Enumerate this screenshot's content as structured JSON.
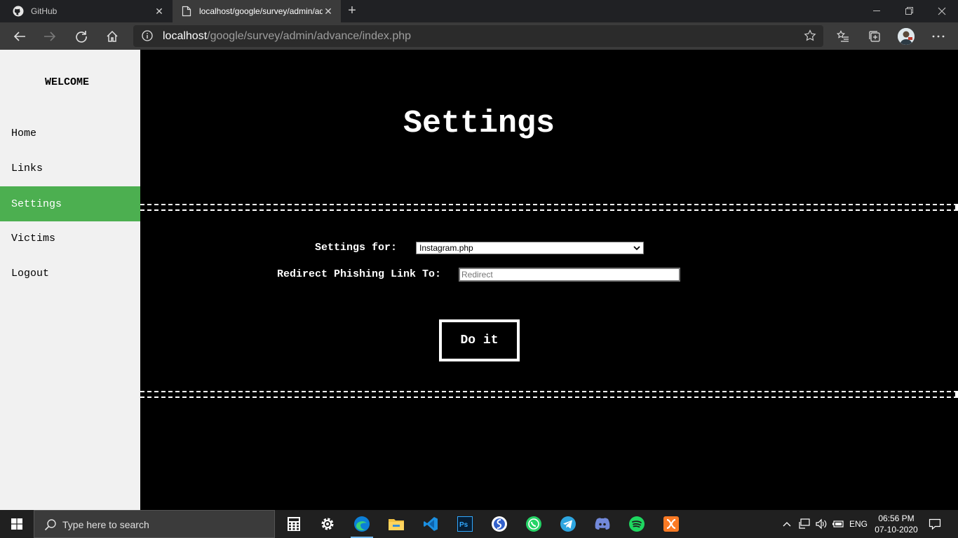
{
  "browser": {
    "tabs": [
      {
        "label": "GitHub",
        "icon": "github-icon"
      },
      {
        "label": "localhost/google/survey/admin/advance/index.php",
        "icon": "page-icon",
        "active": true
      }
    ],
    "url_host": "localhost",
    "url_path": "/google/survey/admin/advance/index.php"
  },
  "sidebar": {
    "welcome": "WELCOME",
    "items": [
      {
        "label": "Home"
      },
      {
        "label": "Links"
      },
      {
        "label": "Settings",
        "active": true
      },
      {
        "label": "Victims"
      },
      {
        "label": "Logout"
      }
    ]
  },
  "main": {
    "title": "Settings",
    "settings_for_label": "Settings for:",
    "settings_for_value": "Instagram.php",
    "redirect_label": "Redirect Phishing Link To:",
    "redirect_placeholder": "Redirect",
    "submit_label": "Do it"
  },
  "taskbar": {
    "search_placeholder": "Type here to search",
    "apps": [
      "calculator-icon",
      "settings-gear-icon",
      "edge-icon",
      "file-explorer-icon",
      "vscode-icon",
      "photoshop-icon",
      "simplenote-icon",
      "whatsapp-icon",
      "telegram-icon",
      "discord-icon",
      "spotify-icon",
      "xampp-icon"
    ],
    "language": "ENG",
    "time": "06:56 PM",
    "date": "07-10-2020"
  },
  "colors": {
    "active_nav": "#4caf50",
    "sidebar_bg": "#f1f1f1",
    "main_bg": "#000000"
  }
}
